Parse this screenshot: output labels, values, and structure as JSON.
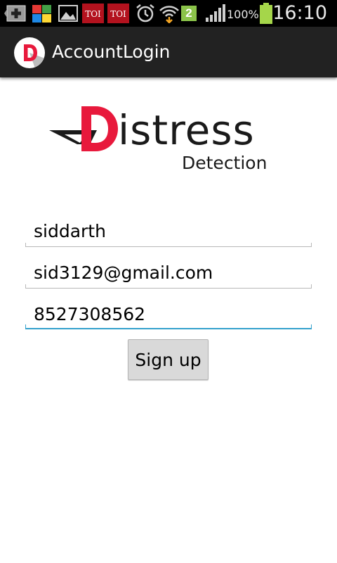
{
  "status_bar": {
    "notification_icons": [
      "add-icon",
      "app-icon",
      "gallery-icon",
      "toi-icon",
      "toi-icon",
      "alarm-icon",
      "wifi-icon",
      "sim-2-icon",
      "signal-icon"
    ],
    "sim_badge": "2",
    "battery_percent": "100%",
    "time": "16:10"
  },
  "action_bar": {
    "title": "AccountLogin",
    "app_icon_letter": "D"
  },
  "logo": {
    "word": "istress",
    "initial": "D",
    "sub": "Detection",
    "brand_color": "#e8193c"
  },
  "form": {
    "name_value": "siddarth",
    "email_value": "sid3129@gmail.com",
    "phone_value": "8527308562",
    "signup_label": "Sign up"
  },
  "colors": {
    "accent": "#33a0cc",
    "action_bar": "#222222",
    "status_bar": "#000000"
  }
}
